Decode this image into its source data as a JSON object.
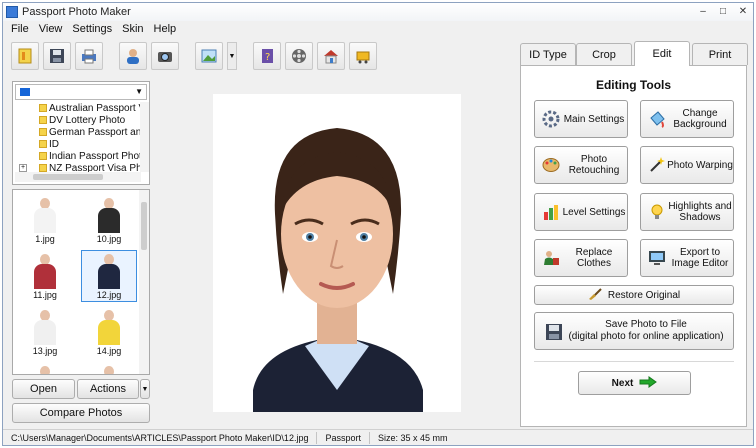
{
  "window": {
    "title": "Passport Photo Maker"
  },
  "menu": [
    "File",
    "View",
    "Settings",
    "Skin",
    "Help"
  ],
  "toolbar": {
    "buttons": [
      "new-icon",
      "save-icon",
      "print-icon",
      "user-card-icon",
      "camera-icon",
      "image-icon",
      "help-book-icon",
      "film-reel-icon",
      "home-icon",
      "cart-icon"
    ]
  },
  "tree": {
    "items": [
      "Australian Passport V",
      "DV Lottery Photo",
      "German Passport an",
      "ID",
      "Indian Passport Phot",
      "NZ Passport Visa Pho"
    ]
  },
  "thumbnails": [
    {
      "caption": "1.jpg",
      "color": "#f3f3f3"
    },
    {
      "caption": "10.jpg",
      "color": "#2b2b2b"
    },
    {
      "caption": "11.jpg",
      "color": "#b0303a"
    },
    {
      "caption": "12.jpg",
      "color": "#1f2740"
    },
    {
      "caption": "13.jpg",
      "color": "#f0f0f0"
    },
    {
      "caption": "14.jpg",
      "color": "#f2d53a"
    },
    {
      "caption": "",
      "color": "#d9c7b0"
    },
    {
      "caption": "",
      "color": "#c9d6e8"
    }
  ],
  "left_buttons": {
    "open": "Open",
    "actions": "Actions",
    "compare": "Compare Photos"
  },
  "tabs": [
    "ID Type",
    "Crop",
    "Edit",
    "Print"
  ],
  "active_tab": "Edit",
  "edit_panel": {
    "title": "Editing Tools",
    "tools": [
      {
        "label": "Main Settings",
        "icon": "gear-icon"
      },
      {
        "label": "Change Background",
        "icon": "paint-bucket-icon"
      },
      {
        "label": "Photo Retouching",
        "icon": "palette-icon"
      },
      {
        "label": "Photo Warping",
        "icon": "magic-wand-icon"
      },
      {
        "label": "Level Settings",
        "icon": "bar-levels-icon"
      },
      {
        "label": "Highlights and Shadows",
        "icon": "lightbulb-icon"
      },
      {
        "label": "Replace Clothes",
        "icon": "clothes-icon"
      },
      {
        "label": "Export to Image Editor",
        "icon": "monitor-export-icon"
      }
    ],
    "restore": "Restore Original",
    "save": "Save Photo to File",
    "save_sub": "(digital photo for online application)",
    "next": "Next"
  },
  "status": {
    "path": "C:\\Users\\Manager\\Documents\\ARTICLES\\Passport Photo Maker\\ID\\12.jpg",
    "type": "Passport",
    "size": "Size: 35 x 45 mm"
  },
  "colors": {
    "accent": "#3d8ee0",
    "next_arrow": "#22a82b",
    "tree_flag": "#1565d8"
  }
}
